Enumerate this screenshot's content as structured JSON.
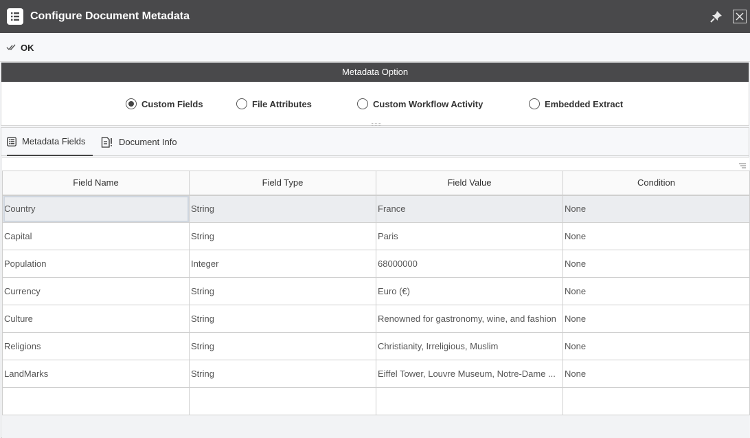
{
  "window": {
    "title": "Configure Document Metadata"
  },
  "toolbar": {
    "ok_label": "OK"
  },
  "metadata_option": {
    "header": "Metadata Option",
    "selected": "Custom Fields",
    "options": [
      {
        "label": "Custom Fields"
      },
      {
        "label": "File Attributes"
      },
      {
        "label": "Custom Workflow Activity"
      },
      {
        "label": "Embedded Extract"
      }
    ]
  },
  "tabs": [
    {
      "label": "Metadata Fields"
    },
    {
      "label": "Document Info"
    }
  ],
  "table": {
    "columns": [
      "Field Name",
      "Field Type",
      "Field Value",
      "Condition"
    ],
    "rows": [
      [
        "Country",
        "String",
        "France",
        "None"
      ],
      [
        "Capital",
        "String",
        "Paris",
        "None"
      ],
      [
        "Population",
        "Integer",
        "68000000",
        "None"
      ],
      [
        "Currency",
        "String",
        "Euro (€)",
        "None"
      ],
      [
        "Culture",
        "String",
        "Renowned for gastronomy, wine, and fashion",
        "None"
      ],
      [
        "Religions",
        "String",
        "Christianity, Irreligious, Muslim",
        "None"
      ],
      [
        "LandMarks",
        "String",
        "Eiffel Tower, Louvre Museum, Notre-Dame ...",
        "None"
      ],
      [
        "",
        "",
        "",
        ""
      ]
    ]
  }
}
